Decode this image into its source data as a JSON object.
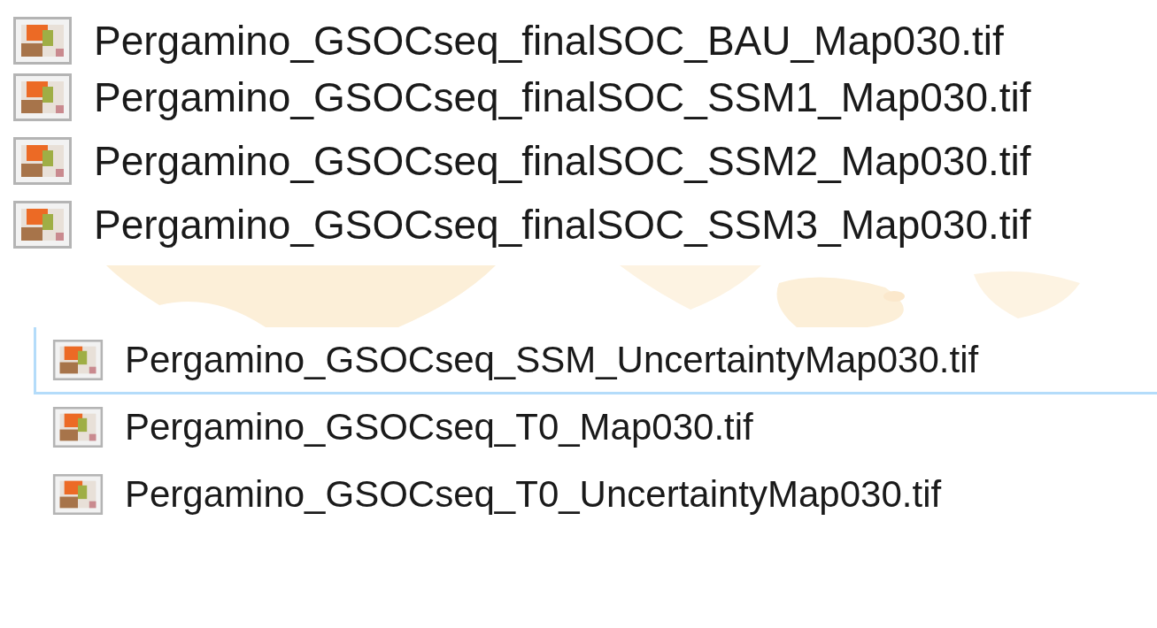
{
  "top_files": [
    {
      "name": "Pergamino_GSOCseq_finalSOC_BAU_Map030.tif"
    },
    {
      "name": "Pergamino_GSOCseq_finalSOC_SSM1_Map030.tif"
    },
    {
      "name": "Pergamino_GSOCseq_finalSOC_SSM2_Map030.tif"
    },
    {
      "name": "Pergamino_GSOCseq_finalSOC_SSM3_Map030.tif"
    }
  ],
  "bottom_files": [
    {
      "name": "Pergamino_GSOCseq_SSM_UncertaintyMap030.tif",
      "selected": true
    },
    {
      "name": "Pergamino_GSOCseq_T0_Map030.tif",
      "selected": false
    },
    {
      "name": "Pergamino_GSOCseq_T0_UncertaintyMap030.tif",
      "selected": false
    }
  ]
}
